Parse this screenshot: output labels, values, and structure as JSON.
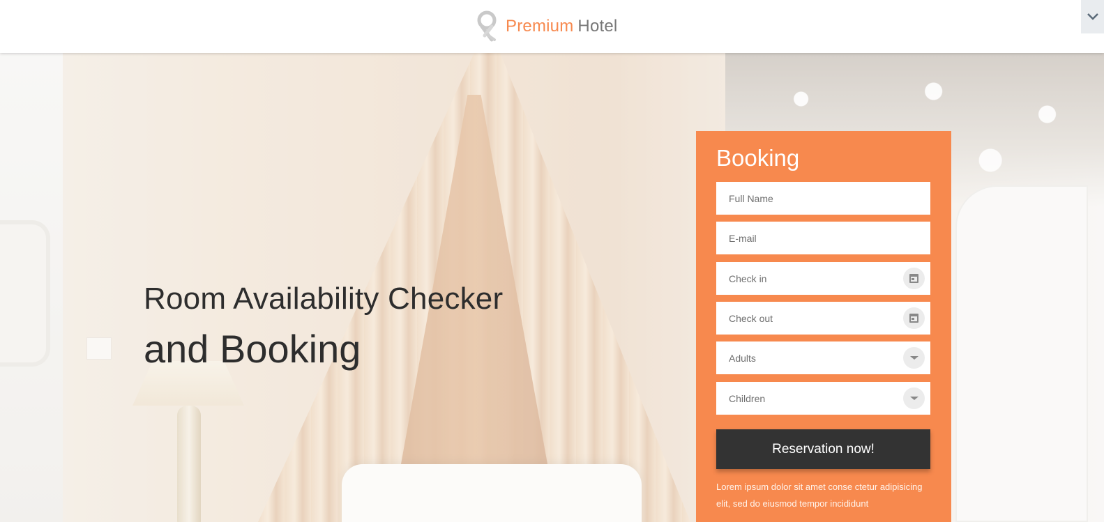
{
  "header": {
    "logo_accent": "Premium",
    "logo_rest": "Hotel",
    "logo_icon": "map-pin-ribbon-icon",
    "toggle_icon": "chevron-down-icon"
  },
  "hero": {
    "title_line1": "Room Availability Checker",
    "title_line2": "and Booking"
  },
  "booking": {
    "title": "Booking",
    "fields": {
      "full_name_placeholder": "Full Name",
      "email_placeholder": "E-mail",
      "check_in_placeholder": "Check in",
      "check_out_placeholder": "Check out",
      "adults_placeholder": "Adults",
      "children_placeholder": "Children"
    },
    "reserve_label": "Reservation now!",
    "note": "Lorem ipsum dolor sit amet conse ctetur adipisicing elit, sed do eiusmod tempor incididunt"
  },
  "colors": {
    "accent": "#f7894e",
    "button": "#333333",
    "text_dark": "#2d2d2d"
  }
}
